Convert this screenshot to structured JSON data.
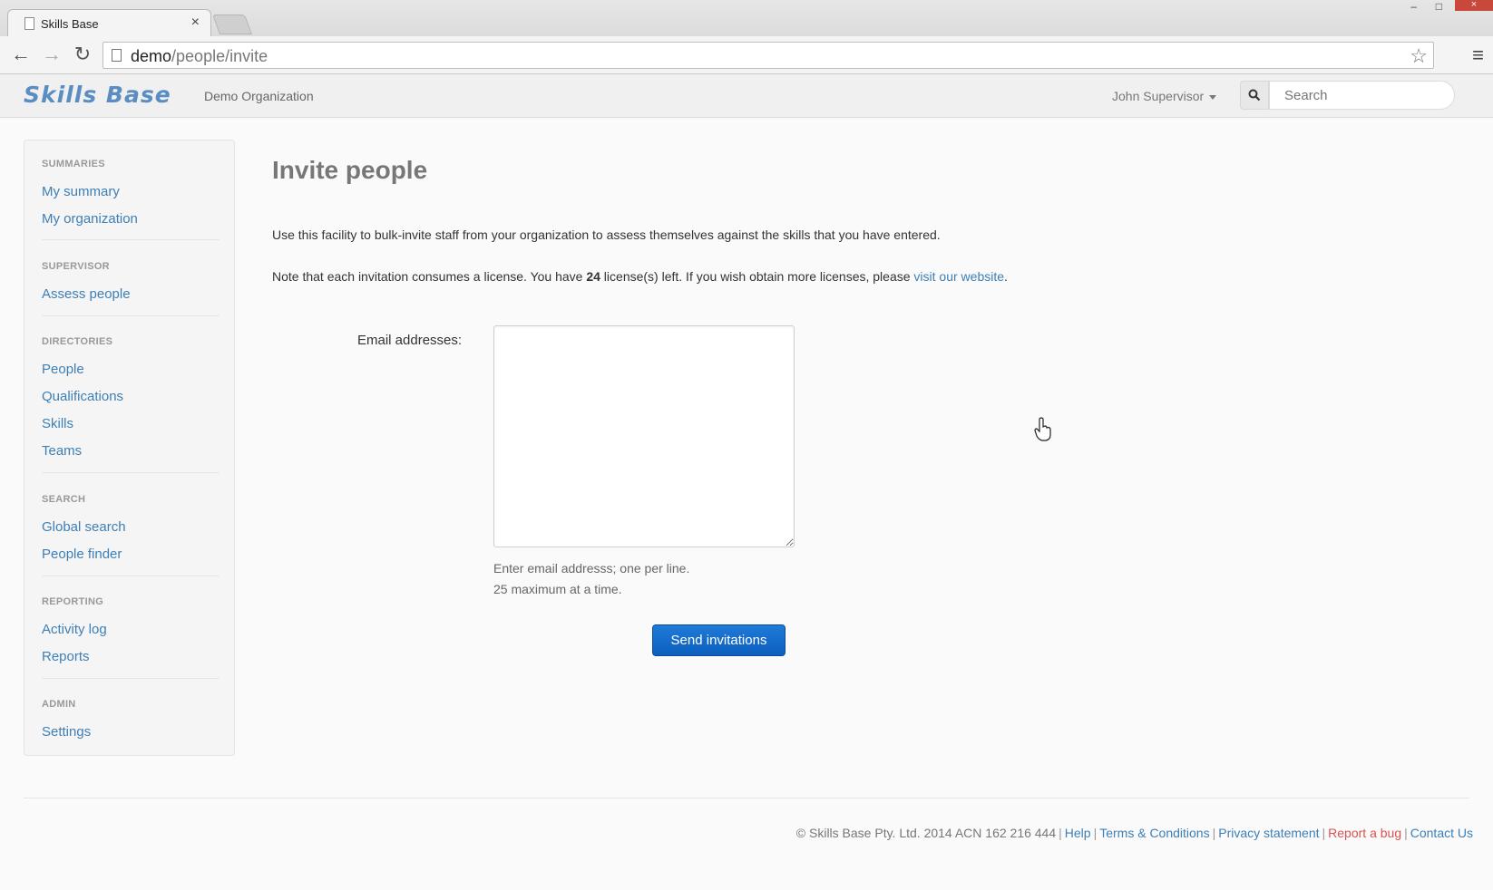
{
  "browser": {
    "tab_title": "Skills Base",
    "tab_close": "×",
    "url_host": "demo",
    "url_path": "/people/invite",
    "window_close": "×"
  },
  "header": {
    "logo": "Skills Base",
    "org_name": "Demo Organization",
    "user_name": "John Supervisor",
    "search_placeholder": "Search"
  },
  "sidebar": {
    "sections": [
      {
        "title": "SUMMARIES",
        "items": [
          "My summary",
          "My organization"
        ]
      },
      {
        "title": "SUPERVISOR",
        "items": [
          "Assess people"
        ]
      },
      {
        "title": "DIRECTORIES",
        "items": [
          "People",
          "Qualifications",
          "Skills",
          "Teams"
        ]
      },
      {
        "title": "SEARCH",
        "items": [
          "Global search",
          "People finder"
        ]
      },
      {
        "title": "REPORTING",
        "items": [
          "Activity log",
          "Reports"
        ]
      },
      {
        "title": "ADMIN",
        "items": [
          "Settings"
        ]
      }
    ]
  },
  "main": {
    "title": "Invite people",
    "intro": "Use this facility to bulk-invite staff from your organization to assess themselves against the skills that you have entered.",
    "note_before": "Note that each invitation consumes a license. You have ",
    "license_count": "24",
    "note_after": " license(s) left. If you wish obtain more licenses, please ",
    "website_link": "visit our website",
    "note_end": ".",
    "email_label": "Email addresses:",
    "email_value": "",
    "help_line1": "Enter email addresss; one per line.",
    "help_line2": "25 maximum at a time.",
    "send_button": "Send invitations"
  },
  "footer": {
    "copyright": "© Skills Base Pty. Ltd. 2014 ACN 162 216 444",
    "links": [
      "Help",
      "Terms & Conditions",
      "Privacy statement",
      "Report a bug",
      "Contact Us"
    ]
  }
}
